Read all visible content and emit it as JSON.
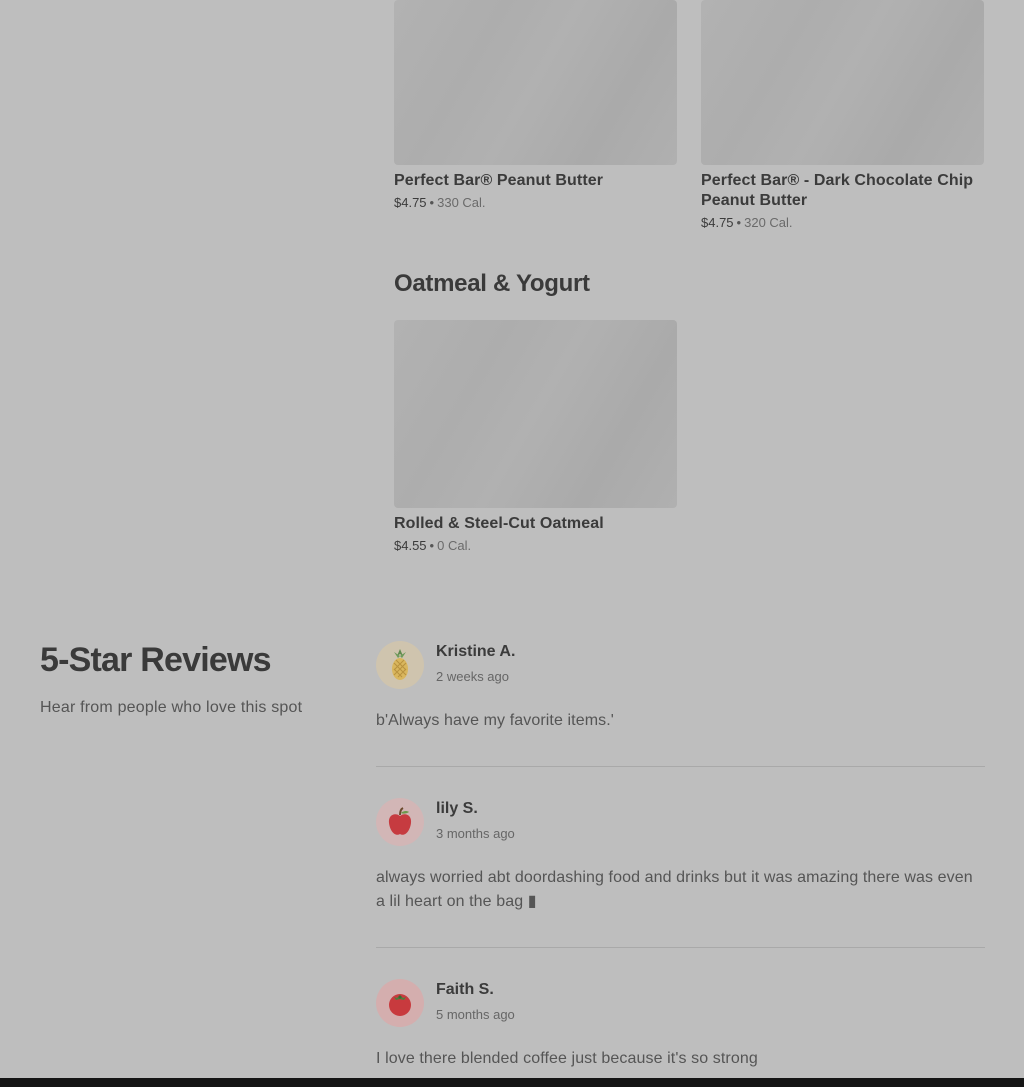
{
  "menu": {
    "items": [
      {
        "name": "Perfect Bar® Peanut Butter",
        "price": "$4.75",
        "separator": "•",
        "calories": "330 Cal."
      },
      {
        "name": "Perfect Bar® - Dark Chocolate Chip Peanut Butter",
        "price": "$4.75",
        "separator": "•",
        "calories": "320 Cal."
      }
    ],
    "sections": [
      {
        "title": "Oatmeal & Yogurt",
        "items": [
          {
            "name": "Rolled & Steel-Cut Oatmeal",
            "price": "$4.55",
            "separator": "•",
            "calories": "0 Cal."
          }
        ]
      }
    ]
  },
  "reviews": {
    "title": "5-Star Reviews",
    "subtitle": "Hear from people who love this spot",
    "items": [
      {
        "author": "Kristine A.",
        "time": "2 weeks ago",
        "text": "b'Always have my favorite items.'",
        "avatar_icon": "pineapple-icon",
        "avatar_bg": "#cfc4ae"
      },
      {
        "author": "lily S.",
        "time": "3 months ago",
        "text": "always worried abt doordashing food and drinks but it was amazing there was even a lil heart on the bag ▮",
        "avatar_icon": "apple-icon",
        "avatar_bg": "#d2b6b6"
      },
      {
        "author": "Faith S.",
        "time": "5 months ago",
        "text": "I love there blended coffee just because it's so strong",
        "avatar_icon": "tomato-icon",
        "avatar_bg": "#d4aeae"
      }
    ]
  }
}
